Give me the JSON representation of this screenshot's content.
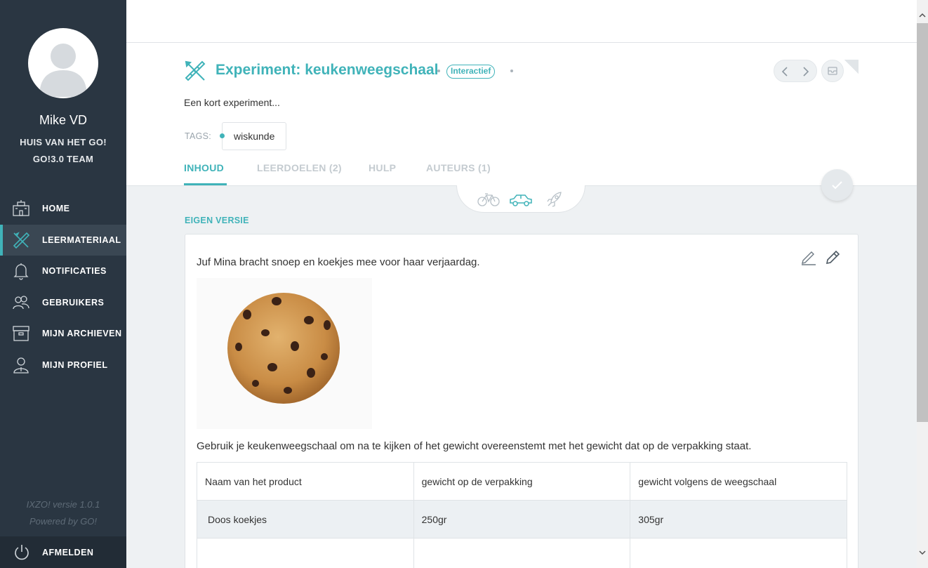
{
  "sidebar": {
    "user_name": "Mike VD",
    "org_line1": "HUIS VAN HET GO!",
    "org_line2": "GO!3.0 TEAM",
    "items": [
      {
        "label": "HOME",
        "icon": "school-icon"
      },
      {
        "label": "LEERMATERIAAL",
        "icon": "pencil-ruler-icon"
      },
      {
        "label": "NOTIFICATIES",
        "icon": "bell-icon"
      },
      {
        "label": "GEBRUIKERS",
        "icon": "users-icon"
      },
      {
        "label": "MIJN ARCHIEVEN",
        "icon": "archive-icon"
      },
      {
        "label": "MIJN PROFIEL",
        "icon": "profile-icon"
      }
    ],
    "version": "IXZO! versie 1.0.1",
    "powered": "Powered by GO!",
    "logout": "AFMELDEN"
  },
  "header": {
    "title": "Experiment: keukenweegschaal",
    "badge": "Interactief",
    "description": "Een kort experiment...",
    "tags_label": "TAGS:",
    "tags": [
      "wiskunde"
    ],
    "tabs": [
      {
        "label": "INHOUD"
      },
      {
        "label": "LEERDOELEN (2)"
      },
      {
        "label": "HULP"
      },
      {
        "label": "AUTEURS (1)"
      }
    ]
  },
  "content": {
    "section_label": "EIGEN VERSIE",
    "intro": "Juf Mina bracht snoep en koekjes mee voor haar verjaardag.",
    "instruction": "Gebruik je keukenweegschaal om na te kijken of het gewicht overeenstemt met het gewicht dat op de verpakking staat.",
    "table": {
      "headers": [
        "Naam van het product",
        "gewicht op de verpakking",
        "gewicht volgens de weegschaal"
      ],
      "rows": [
        [
          "Doos koekjes",
          "250gr",
          "305gr"
        ],
        [
          "",
          "",
          ""
        ]
      ]
    }
  },
  "colors": {
    "accent": "#40b3b9",
    "sidebar": "#2a3642"
  }
}
